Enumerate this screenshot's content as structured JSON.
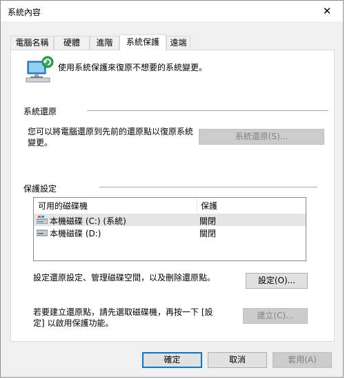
{
  "window": {
    "title": "系統內容",
    "close_glyph": "✕"
  },
  "tabs": [
    {
      "label": "電腦名稱"
    },
    {
      "label": "硬體"
    },
    {
      "label": "進階"
    },
    {
      "label": "系統保護"
    },
    {
      "label": "遠端"
    }
  ],
  "active_tab": "系統保護",
  "intro": {
    "icon": "system-protection-icon",
    "text": "使用系統保護來復原不想要的系統變更。"
  },
  "restore": {
    "group_title": "系統還原",
    "description_line1": "您可以將電腦還原到先前的還原點以復原系統",
    "description_line2": "變更。",
    "button_label": "系統還原(S)...",
    "button_enabled": false
  },
  "protection": {
    "group_title": "保護設定",
    "columns": [
      "可用的磁碟機",
      "保護"
    ],
    "drives": [
      {
        "name": "本機磁碟 (C:) (系統)",
        "status": "關閉",
        "icon": "system-drive-icon",
        "selected": true
      },
      {
        "name": "本機磁碟 (D:)",
        "status": "關閉",
        "icon": "drive-icon",
        "selected": false
      }
    ],
    "configure_text": "設定還原設定、管理磁碟空間，以及刪除還原點。",
    "configure_button": "設定(O)...",
    "create_text_line1": "若要建立還原點，請先選取磁碟機，再按一下 [設",
    "create_text_line2": "定] 以啟用保護功能。",
    "create_button": "建立(C)...",
    "create_enabled": false
  },
  "footer": {
    "ok": "確定",
    "cancel": "取消",
    "apply": "套用(A)",
    "apply_enabled": false
  },
  "colors": {
    "accent": "#0078d7",
    "window_bg": "#f0f0f0",
    "panel_bg": "#ffffff",
    "disabled_text": "#838383"
  }
}
